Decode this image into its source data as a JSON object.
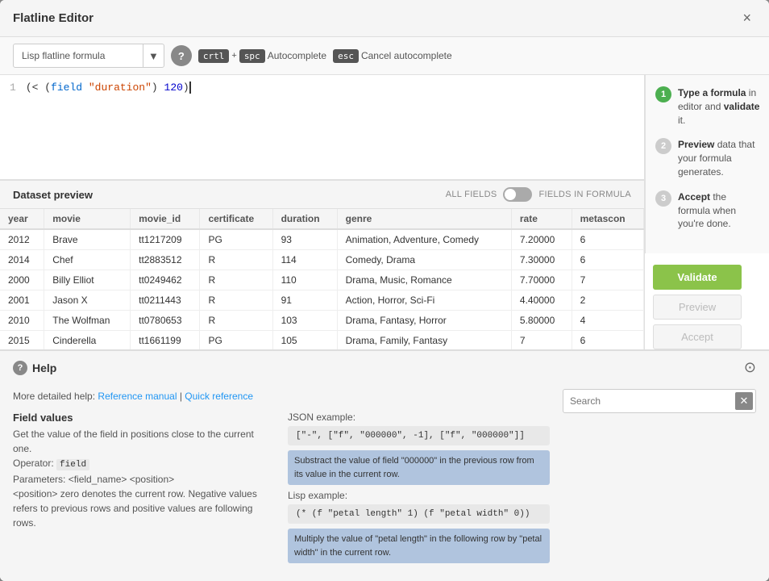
{
  "modal": {
    "title": "Flatline Editor",
    "close_label": "×"
  },
  "toolbar": {
    "formula_placeholder": "Lisp flatline formula",
    "dropdown_arrow": "▼",
    "help_label": "?",
    "kbd1": "crtl",
    "plus": "+",
    "kbd2": "spc",
    "autocomplete_label": "Autocomplete",
    "esc_kbd": "esc",
    "cancel_label": "Cancel autocomplete"
  },
  "steps": [
    {
      "num": "1",
      "active": true,
      "text": "Type a formula",
      "suffix": " in editor and ",
      "action": "validate",
      "end": " it."
    },
    {
      "num": "2",
      "active": false,
      "text_bold": "Preview",
      "text_rest": " data that your formula generates."
    },
    {
      "num": "3",
      "active": false,
      "text_bold": "Accept",
      "text_rest": " the formula when you're done."
    }
  ],
  "editor": {
    "line_number": "1",
    "code": "(< (field \"duration\") 120)"
  },
  "dataset_preview": {
    "title": "Dataset preview",
    "toggle_left": "ALL FIELDS",
    "toggle_right": "FIELDS IN FORMULA",
    "columns": [
      "year",
      "movie",
      "movie_id",
      "certificate",
      "duration",
      "genre",
      "rate",
      "metascon"
    ],
    "rows": [
      [
        "2012",
        "Brave",
        "tt1217209",
        "PG",
        "93",
        "Animation, Adventure, Comedy",
        "7.20000",
        "6"
      ],
      [
        "2014",
        "Chef",
        "tt2883512",
        "R",
        "114",
        "Comedy, Drama",
        "7.30000",
        "6"
      ],
      [
        "2000",
        "Billy Elliot",
        "tt0249462",
        "R",
        "110",
        "Drama, Music, Romance",
        "7.70000",
        "7"
      ],
      [
        "2001",
        "Jason X",
        "tt0211443",
        "R",
        "91",
        "Action, Horror, Sci-Fi",
        "4.40000",
        "2"
      ],
      [
        "2010",
        "The Wolfman",
        "tt0780653",
        "R",
        "103",
        "Drama, Fantasy, Horror",
        "5.80000",
        "4"
      ],
      [
        "2015",
        "Cinderella",
        "tt1661199",
        "PG",
        "105",
        "Drama, Family, Fantasy",
        "7",
        "6"
      ]
    ]
  },
  "buttons": {
    "validate": "Validate",
    "preview": "Preview",
    "accept": "Accept"
  },
  "help": {
    "title": "Help",
    "links_prefix": "More detailed help:",
    "ref_manual": "Reference manual",
    "separator": "|",
    "quick_ref": "Quick reference",
    "search_placeholder": "Search",
    "topic_title": "Field values",
    "topic_desc1": "Get the value of the field in positions close to the current one.",
    "topic_operator": "Operator:",
    "topic_operator_code": "field",
    "topic_params": "Parameters: <field_name> <position>",
    "topic_detail": "<position> zero denotes the current row. Negative values refers to previous rows and positive values are following rows.",
    "json_label": "JSON example:",
    "json_code": "[\"-\", [\"f\", \"000000\", -1], [\"f\", \"000000\"]]",
    "json_highlight": "Substract the value of field \"000000\" in the previous row from its value in the current row.",
    "lisp_label": "Lisp example:",
    "lisp_code": "(* (f \"petal length\" 1) (f \"petal width\" 0))",
    "lisp_highlight": "Multiply the value of \"petal length\" in the following row by \"petal width\" in the current row."
  }
}
